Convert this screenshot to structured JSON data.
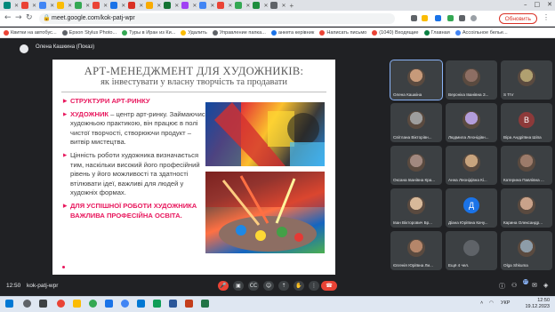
{
  "browser": {
    "url": "meet.google.com/kok-patj-wpr",
    "update_label": "Обновить",
    "bookmarks": [
      {
        "label": "Квитки на автобус..."
      },
      {
        "label": "Epson Stylus Photo..."
      },
      {
        "label": "Туры в Иран из Ки..."
      },
      {
        "label": "Удалить"
      },
      {
        "label": "Управление папка..."
      },
      {
        "label": "анкета керівник"
      },
      {
        "label": "Написать письмо"
      },
      {
        "label": "(1040) Входящие"
      },
      {
        "label": "Главная"
      },
      {
        "label": "Ассоільное белье..."
      }
    ]
  },
  "meet": {
    "presenter_label": "Олена Кашкина (Показ)",
    "time": "12:50",
    "meeting_code": "kok-patj-wpr",
    "participants_count": "27"
  },
  "slide": {
    "title": "АРТ-МЕНЕДЖМЕНТ ДЛЯ ХУДОЖНИКІВ:",
    "subtitle": "як інвестувати у власну творчість та продавати",
    "bullet1": "СТРУКТУРИ АРТ-РИНКУ",
    "bullet2_head": "ХУДОЖНИК",
    "bullet2_body": " – центр арт-ринку. Займаючись художньою практикою, він працює в полі чистої творчості, створюючи продукт – витвір мистецтва.",
    "bullet3": "Цінність роботи художника визначається тим, наскільки високий його професійний рівень у його можливості та здатності втілювати ідеї, важливі для людей у художніх формах.",
    "bullet4": "ДЛЯ УСПІШНОЇ РОБОТИ ХУДОЖНИКА ВАЖЛИВА ПРОФЕСІЙНА ОСВІТА."
  },
  "participants": [
    {
      "name": "Олена Кашкіна",
      "kind": "photo",
      "color": "#c79a7a"
    },
    {
      "name": "Вероніка Іванівна З...",
      "kind": "photo",
      "color": "#8d6e63"
    },
    {
      "name": "S TIV",
      "kind": "photo",
      "color": "#b0a070"
    },
    {
      "name": "Світлана Вікторівн...",
      "kind": "photo",
      "color": "#9e9e9e"
    },
    {
      "name": "Людмила Леонідівн...",
      "kind": "photo",
      "color": "#b39ddb"
    },
    {
      "name": "Віра Андріївна Шіпа",
      "kind": "letter",
      "letter": "В",
      "color": "#8d3a3a"
    },
    {
      "name": "Оксана Іванівна Кра...",
      "kind": "photo",
      "color": "#a1887f"
    },
    {
      "name": "Анна Леонідівна Кі...",
      "kind": "photo",
      "color": "#c8a47e"
    },
    {
      "name": "Катерина Павлівна ...",
      "kind": "photo",
      "color": "#9c7b6a"
    },
    {
      "name": "Іван Вікторович Бр...",
      "kind": "photo",
      "color": "#d7b99a"
    },
    {
      "name": "Діана Юріївна Качу...",
      "kind": "letter",
      "letter": "Д",
      "color": "#1a73e8"
    },
    {
      "name": "Карина Олександр...",
      "kind": "photo",
      "color": "#c9a28a"
    },
    {
      "name": "Євгенія Юріївна Ли...",
      "kind": "photo",
      "color": "#b5866a"
    },
    {
      "name": "Ещё 4 чел.",
      "kind": "more",
      "color": "#5f6368"
    },
    {
      "name": "Olga Shkuma",
      "kind": "photo",
      "color": "#8d9ca8"
    }
  ],
  "taskbar": {
    "time": "12:50",
    "date": "19.12.2023",
    "lang": "УКР"
  }
}
